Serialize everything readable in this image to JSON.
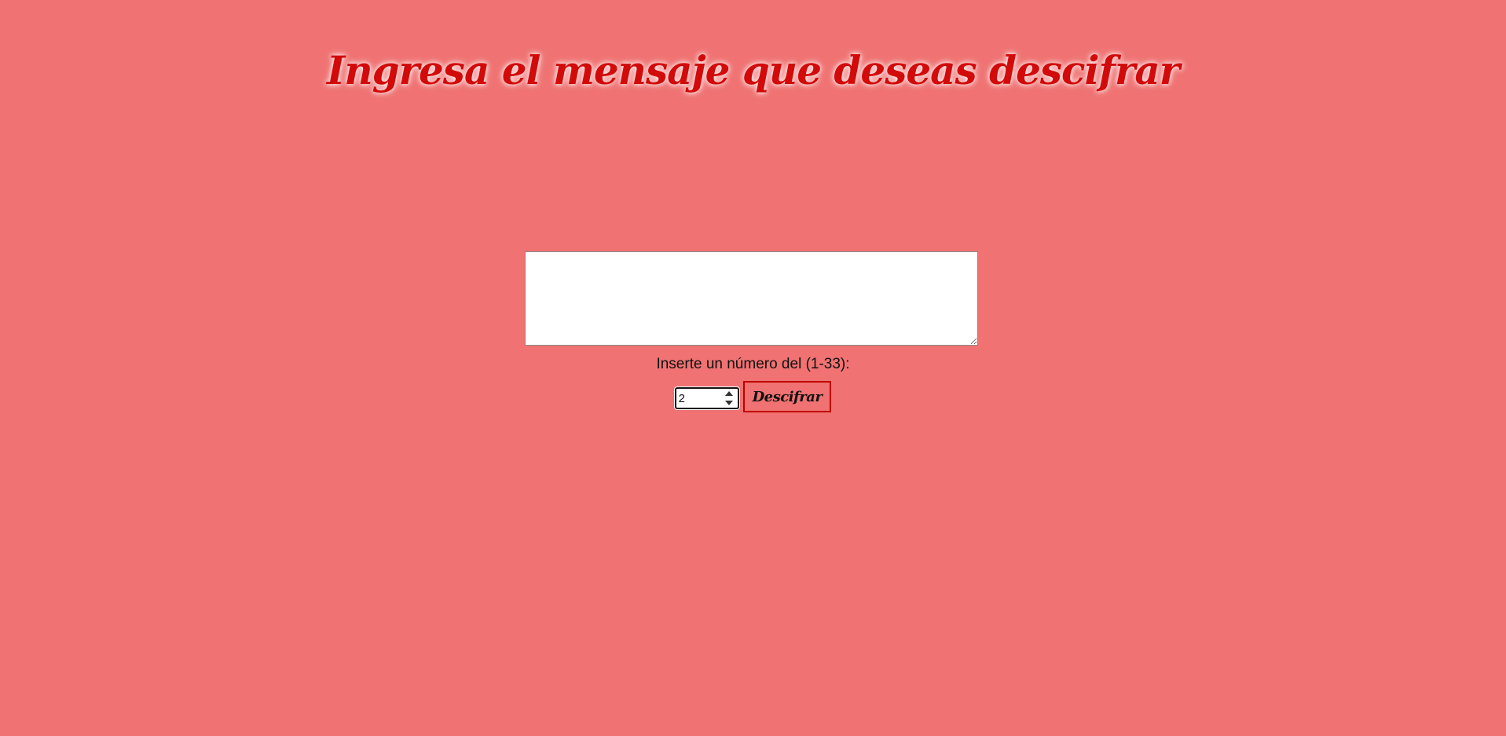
{
  "header": {
    "title": "Ingresa el mensaje que deseas descifrar"
  },
  "form": {
    "message_value": "",
    "number_prompt": "Inserte un número del (1-33):",
    "number_value": "2",
    "number_min": "1",
    "number_max": "33",
    "decrypt_label": "Descifrar"
  },
  "colors": {
    "background": "#f07272",
    "title": "#d20a0a",
    "button_border": "#c00000"
  },
  "icons": {
    "spinner": "up-down-arrows-icon"
  }
}
